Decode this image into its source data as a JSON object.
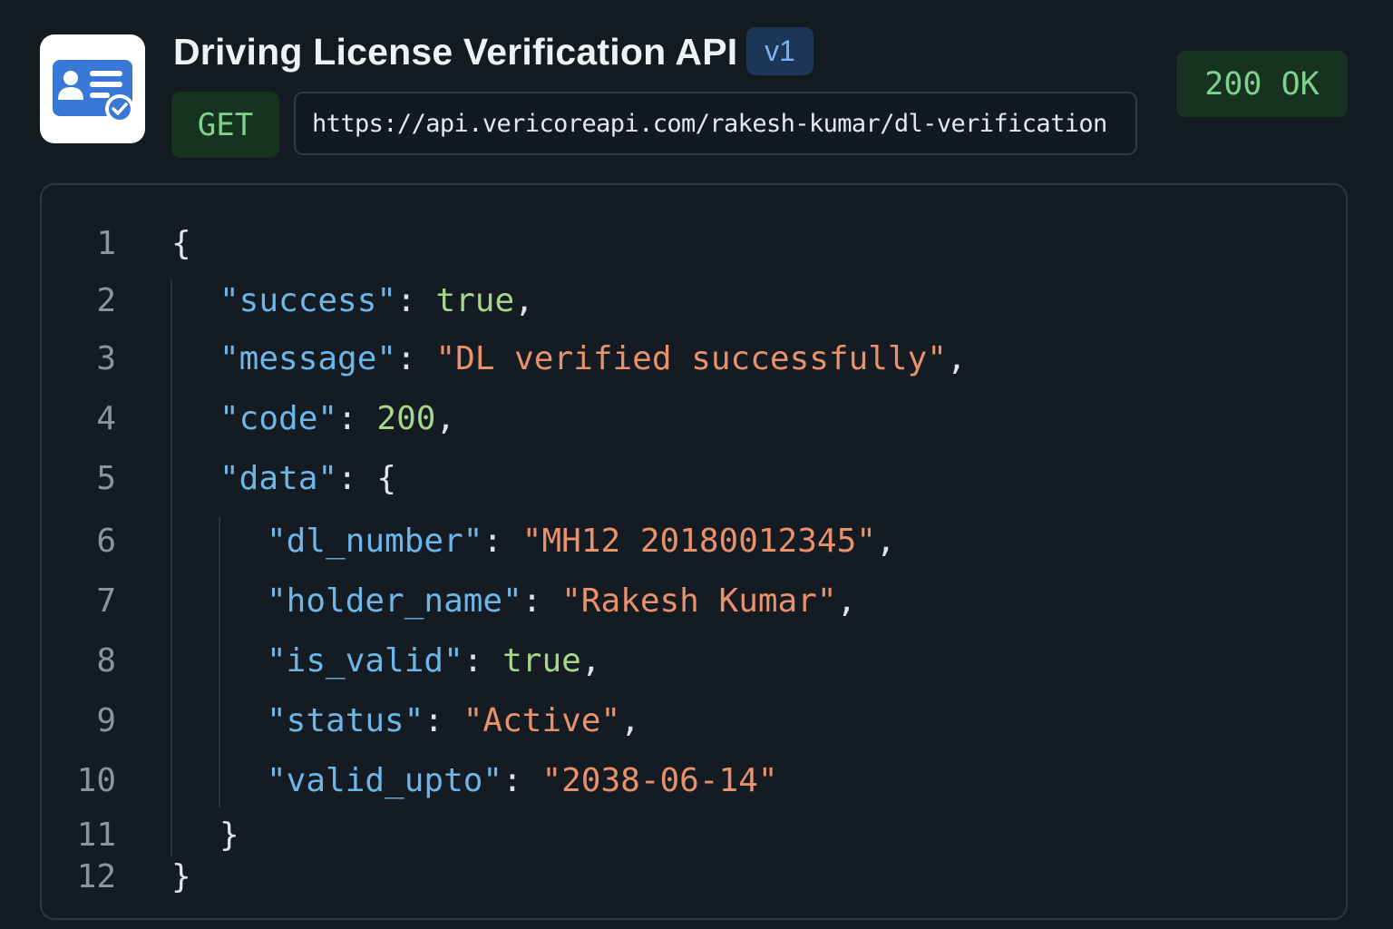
{
  "header": {
    "title": "Driving License Verification API",
    "version": "v1",
    "method": "GET",
    "url": "https://api.vericoreapi.com/rakesh-kumar/dl-verification",
    "status": "200 OK",
    "app_icon": "id-card-verified-icon"
  },
  "colors": {
    "key": "#6cb6e8",
    "string": "#e8916a",
    "literal": "#a7d58a",
    "status_green": "#7fd18f",
    "badge_blue": "#7ab3f0"
  },
  "response": {
    "lines": [
      {
        "n": "1",
        "indent": 0,
        "tokens": [
          {
            "t": "{",
            "c": "p"
          }
        ]
      },
      {
        "n": "2",
        "indent": 1,
        "tokens": [
          {
            "t": "\"success\"",
            "c": "k"
          },
          {
            "t": ": ",
            "c": "p"
          },
          {
            "t": "true",
            "c": "b"
          },
          {
            "t": ",",
            "c": "p"
          }
        ]
      },
      {
        "n": "3",
        "indent": 1,
        "tokens": [
          {
            "t": "\"message\"",
            "c": "k"
          },
          {
            "t": ": ",
            "c": "p"
          },
          {
            "t": "\"DL verified successfully\"",
            "c": "s"
          },
          {
            "t": ",",
            "c": "p"
          }
        ]
      },
      {
        "n": "4",
        "indent": 1,
        "tokens": [
          {
            "t": "\"code\"",
            "c": "k"
          },
          {
            "t": ": ",
            "c": "p"
          },
          {
            "t": "200",
            "c": "n"
          },
          {
            "t": ",",
            "c": "p"
          }
        ]
      },
      {
        "n": "5",
        "indent": 1,
        "tokens": [
          {
            "t": "\"data\"",
            "c": "k"
          },
          {
            "t": ": {",
            "c": "p"
          }
        ]
      },
      {
        "n": "6",
        "indent": 2,
        "tokens": [
          {
            "t": "\"dl_number\"",
            "c": "k"
          },
          {
            "t": ": ",
            "c": "p"
          },
          {
            "t": "\"MH12 20180012345\"",
            "c": "s"
          },
          {
            "t": ",",
            "c": "p"
          }
        ]
      },
      {
        "n": "7",
        "indent": 2,
        "tokens": [
          {
            "t": "\"holder_name\"",
            "c": "k"
          },
          {
            "t": ": ",
            "c": "p"
          },
          {
            "t": "\"Rakesh Kumar\"",
            "c": "s"
          },
          {
            "t": ",",
            "c": "p"
          }
        ]
      },
      {
        "n": "8",
        "indent": 2,
        "tokens": [
          {
            "t": "\"is_valid\"",
            "c": "k"
          },
          {
            "t": ": ",
            "c": "p"
          },
          {
            "t": "true",
            "c": "b"
          },
          {
            "t": ",",
            "c": "p"
          }
        ]
      },
      {
        "n": "9",
        "indent": 2,
        "tokens": [
          {
            "t": "\"status\"",
            "c": "k"
          },
          {
            "t": ": ",
            "c": "p"
          },
          {
            "t": "\"Active\"",
            "c": "s"
          },
          {
            "t": ",",
            "c": "p"
          }
        ]
      },
      {
        "n": "10",
        "indent": 2,
        "tokens": [
          {
            "t": "\"valid_upto\"",
            "c": "k"
          },
          {
            "t": ": ",
            "c": "p"
          },
          {
            "t": "\"2038-06-14\"",
            "c": "s"
          }
        ]
      },
      {
        "n": "11",
        "indent": 1,
        "tokens": [
          {
            "t": "}",
            "c": "p"
          }
        ]
      },
      {
        "n": "12",
        "indent": 0,
        "tokens": [
          {
            "t": "}",
            "c": "p"
          }
        ]
      }
    ]
  }
}
